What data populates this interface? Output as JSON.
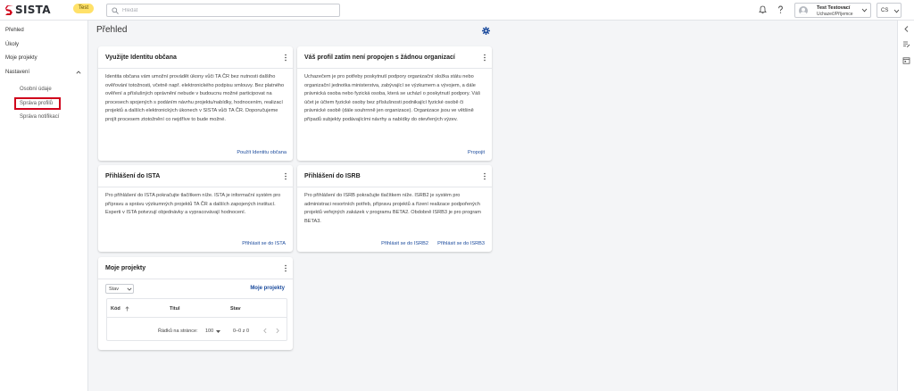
{
  "header": {
    "logo_text": "SISTA",
    "env_badge": "Test",
    "search_placeholder": "Hledat",
    "user_name": "Test Testovací",
    "user_role": "Uchazeč/Příjemce",
    "language": "CS"
  },
  "sidebar": {
    "items": [
      {
        "label": "Přehled"
      },
      {
        "label": "Úkoly"
      },
      {
        "label": "Moje projekty"
      },
      {
        "label": "Nastavení"
      }
    ],
    "sub_items": [
      {
        "label": "Osobní údaje"
      },
      {
        "label": "Správa profilů"
      },
      {
        "label": "Správa notifikací"
      }
    ]
  },
  "main": {
    "page_title": "Přehled",
    "cards": {
      "identity": {
        "title": "Využijte Identitu občana",
        "body": "Identita občana vám umožní provádět úkony vůči TA ČR bez nutnosti dalšího ověřování totožnosti, včetně např. elektronického podpisu smlouvy. Bez platného ověření a příslušných oprávnění nebude v budoucnu možné participovat na procesech spojených s podáním návrhu projektu/nabídky, hodnocením, realizací projektů a dalších elektronických úkonech v SISTA vůči TA ČR. Doporučujeme projít procesem ztotožnění co nejdříve to bude možné.",
        "action": "Použít Identitu občana"
      },
      "organization": {
        "title": "Váš profil zatím není propojen s žádnou organizací",
        "body": "Uchazečem je pro potřeby poskytnutí podpory organizační složka státu nebo organizační jednotka ministerstva, zabývající se výzkumem a vývojem, a dále právnická osoba nebo fyzická osoba, která se uchází o poskytnutí podpory. Váš účet je účtem fyzické osoby bez příslušnosti podnikající fyzické osobě či právnické osobě (dále souhrnně jen organizace). Organizace jsou ve většině případů subjekty podávajícími návrhy a nabídky do otevřených výzev.",
        "action": "Propojit"
      },
      "ista": {
        "title": "Přihlášení do ISTA",
        "body": "Pro přihlášení do ISTA pokračujte tlačítkem níže. ISTA je informační systém pro přípravu a správu výzkumných projektů TA ČR a dalších zapojených institucí. Experti v ISTA potvrzují objednávky a vypracovávají hodnocení.",
        "action": "Přihlásit se do ISTA"
      },
      "isrb": {
        "title": "Přihlášení do ISRB",
        "body": "Pro přihlášení do ISRB pokračujte tlačítkem níže. ISRB2 je systém pro administraci resortních potřeb, přípravu projektů a řízení realizace podpořených projektů veřejných zakázek v programu BETA2. Obdobně ISRB3 je pro program BETA3.",
        "action_1": "Přihlásit se do ISRB2",
        "action_2": "Přihlásit se do ISRB3"
      },
      "projects": {
        "title": "Moje projekty",
        "filter_label": "Stav",
        "link": "Moje projekty",
        "columns": [
          "Kód",
          "Titul",
          "Stav"
        ],
        "rows_per_page_label": "Řádků na stránce:",
        "rows_per_page_value": "100",
        "range": "0–0 z 0"
      }
    }
  },
  "colors": {
    "accent": "#1a4a9c",
    "badge": "#ffe169",
    "highlight": "#d0021b",
    "logo_red": "#d0021b"
  }
}
